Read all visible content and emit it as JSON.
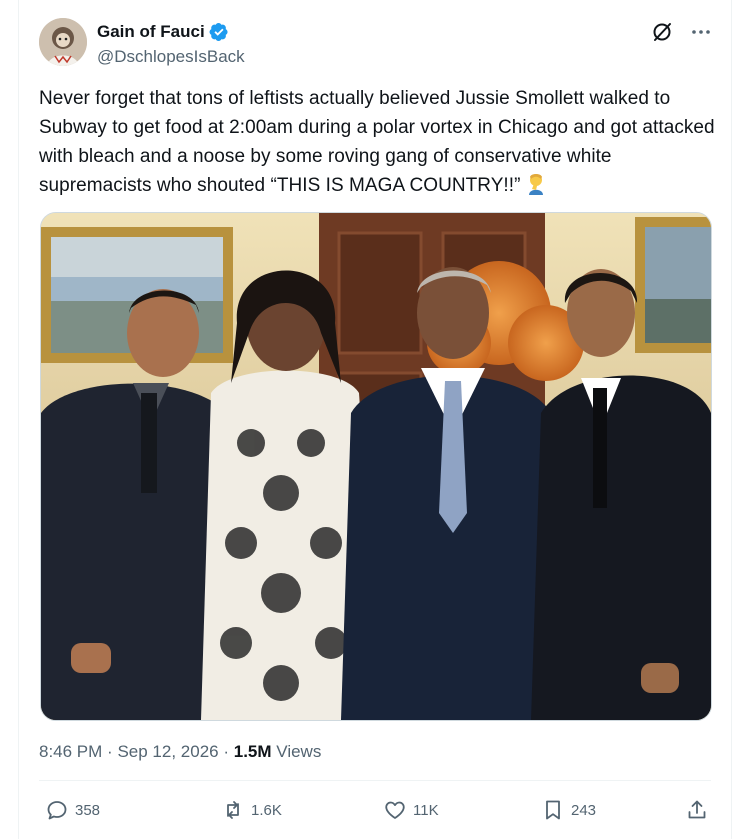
{
  "author": {
    "display_name": "Gain of Fauci",
    "handle": "@DschlopesIsBack",
    "verified": true,
    "verified_color": "#1d9bf0"
  },
  "tweet": {
    "text": "Never forget that tons of leftists actually believed Jussie Smollett walked to Subway to get food at 2:00am during a polar vortex in Chicago and got attacked with bleach and a noose by some roving gang of conservative white supremacists who shouted “THIS IS MAGA COUNTRY!!”",
    "emoji": "person-facepalming",
    "time": "8:46 PM",
    "separator": "·",
    "date": "Sep 12, 2026",
    "views_count": "1.5M",
    "views_label": "Views"
  },
  "actions": {
    "replies": "358",
    "reposts": "1.6K",
    "likes": "11K",
    "bookmarks": "243"
  },
  "icons": {
    "top_right": [
      "grok-icon",
      "more-icon"
    ],
    "action_bar": [
      "reply-icon",
      "repost-icon",
      "like-icon",
      "bookmark-icon",
      "share-icon"
    ]
  },
  "colors": {
    "text": "#0f1419",
    "secondary": "#536471",
    "border": "#eff3f4",
    "accent": "#1d9bf0"
  }
}
